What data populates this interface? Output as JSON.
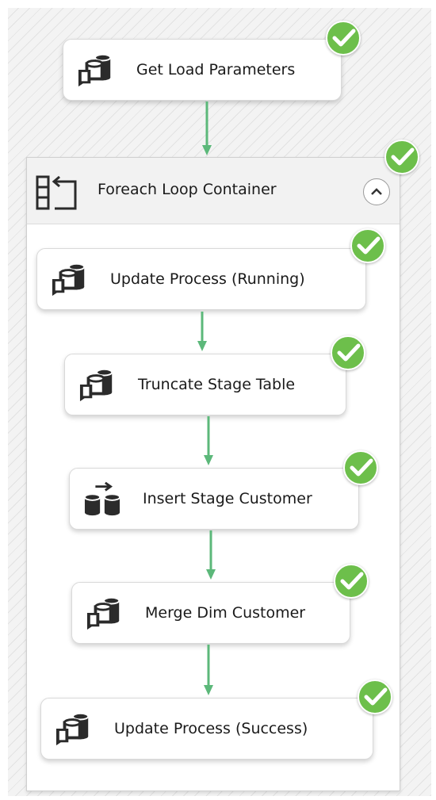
{
  "package": {
    "tasks": [
      {
        "label": "Get Load Parameters",
        "icon": "execute-sql-task-icon",
        "status": "success"
      }
    ],
    "container": {
      "title": "Foreach Loop Container",
      "icon": "foreach-loop-icon",
      "status": "success",
      "collapse_icon": "chevron-up-icon",
      "tasks": [
        {
          "label": "Update Process (Running)",
          "icon": "execute-sql-task-icon",
          "status": "success"
        },
        {
          "label": "Truncate Stage Table",
          "icon": "execute-sql-task-icon",
          "status": "success"
        },
        {
          "label": "Insert Stage Customer",
          "icon": "data-flow-task-icon",
          "status": "success"
        },
        {
          "label": "Merge Dim Customer",
          "icon": "execute-sql-task-icon",
          "status": "success"
        },
        {
          "label": "Update Process (Success)",
          "icon": "execute-sql-task-icon",
          "status": "success"
        }
      ]
    }
  },
  "colors": {
    "success_green": "#6dbf4b",
    "connector_green": "#5cb87a",
    "icon_dark": "#2b2b2b"
  }
}
